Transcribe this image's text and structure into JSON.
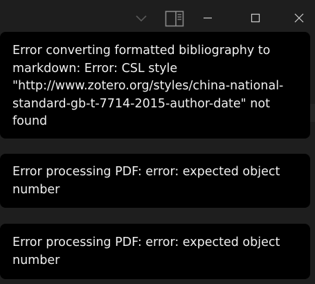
{
  "window": {
    "controls": {
      "dropdown_icon": "chevron-down-icon",
      "sidebar_toggle_icon": "sidebar-toggle-icon",
      "minimize_icon": "minimize-icon",
      "maximize_icon": "maximize-icon",
      "close_icon": "close-icon"
    }
  },
  "notifications": [
    {
      "message": "Error converting formatted bibliography to\nmarkdown: Error: CSL style\n\"http://www.zotero.org/styles/china-national-\nstandard-gb-t-7714-2015-author-date\" not\nfound"
    },
    {
      "message": "Error processing PDF: error: expected object\nnumber"
    },
    {
      "message": "Error processing PDF: error: expected object\nnumber"
    }
  ],
  "colors": {
    "background": "#1e1e1e",
    "toast_background": "#000000",
    "toast_text": "#f0f0f0",
    "icon": "#8a8a8a"
  }
}
